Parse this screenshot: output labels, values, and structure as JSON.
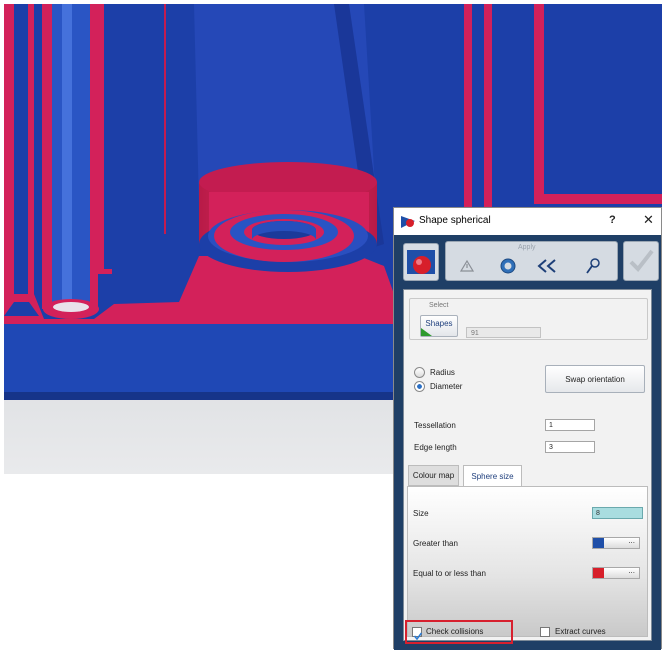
{
  "dialog": {
    "title": "Shape spherical",
    "help_label": "?",
    "close_label": "✕",
    "toolbar": {
      "apply_label": "Apply",
      "buttons": [
        "warning-icon",
        "settings-gear-icon",
        "double-chevron-left-icon",
        "pick-icon"
      ],
      "ok": "checkmark-icon"
    },
    "select": {
      "group_label": "Select",
      "shapes_label": "Shapes",
      "count": "91"
    },
    "mode": {
      "options": [
        "Radius",
        "Diameter"
      ],
      "selected": "Diameter"
    },
    "swap_label": "Swap orientation",
    "tessellation": {
      "label": "Tessellation",
      "value": "1"
    },
    "edge_length": {
      "label": "Edge length",
      "value": "3"
    },
    "tabs": [
      "Colour map",
      "Sphere size"
    ],
    "active_tab": "Sphere size",
    "sphere_size": {
      "size_label": "Size",
      "size_value": "8",
      "greater_label": "Greater than",
      "greater_color": "#1f4fa8",
      "equal_label": "Equal to or less than",
      "equal_color": "#d71f2a",
      "dots": "..."
    },
    "check_collisions": {
      "label": "Check collisions",
      "checked": true
    },
    "extract_curves": {
      "label": "Extract curves",
      "checked": false
    }
  },
  "colors": {
    "part_blue": "#1c3fa8",
    "collision_red": "#d3215a",
    "dialog_body": "#1f3f66",
    "highlight": "#d7202e"
  }
}
